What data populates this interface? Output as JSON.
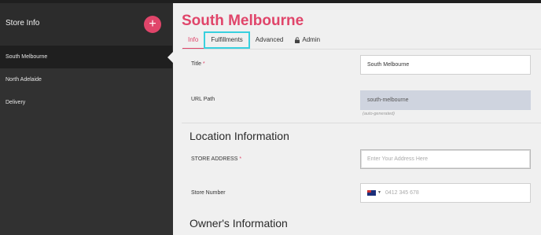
{
  "sidebar": {
    "title": "Store Info",
    "add_label": "+",
    "items": [
      {
        "label": "South Melbourne"
      },
      {
        "label": "North Adelaide"
      },
      {
        "label": "Delivery"
      }
    ]
  },
  "main": {
    "title": "South Melbourne",
    "tabs": [
      {
        "label": "Info"
      },
      {
        "label": "Fulfillments"
      },
      {
        "label": "Advanced"
      },
      {
        "label": "Admin"
      }
    ],
    "fields": {
      "title": {
        "label": "Title",
        "required": "*",
        "value": "South Melbourne"
      },
      "url_path": {
        "label": "URL Path",
        "value": "south-melbourne",
        "hint": "(auto-generated)"
      },
      "store_address": {
        "label": "STORE ADDRESS",
        "required": "*",
        "placeholder": "Enter Your Address Here"
      },
      "store_number": {
        "label": "Store Number",
        "placeholder": "0412 345 678"
      }
    },
    "sections": {
      "location": "Location Information",
      "owner": "Owner's Information"
    }
  },
  "colors": {
    "accent": "#e0456a",
    "highlight": "#38d0de",
    "sidebar_bg": "#313131",
    "main_bg": "#f0f0f0"
  },
  "icons": {
    "add": "plus-icon",
    "lock": "lock-icon",
    "flag": "australia-flag-icon"
  }
}
